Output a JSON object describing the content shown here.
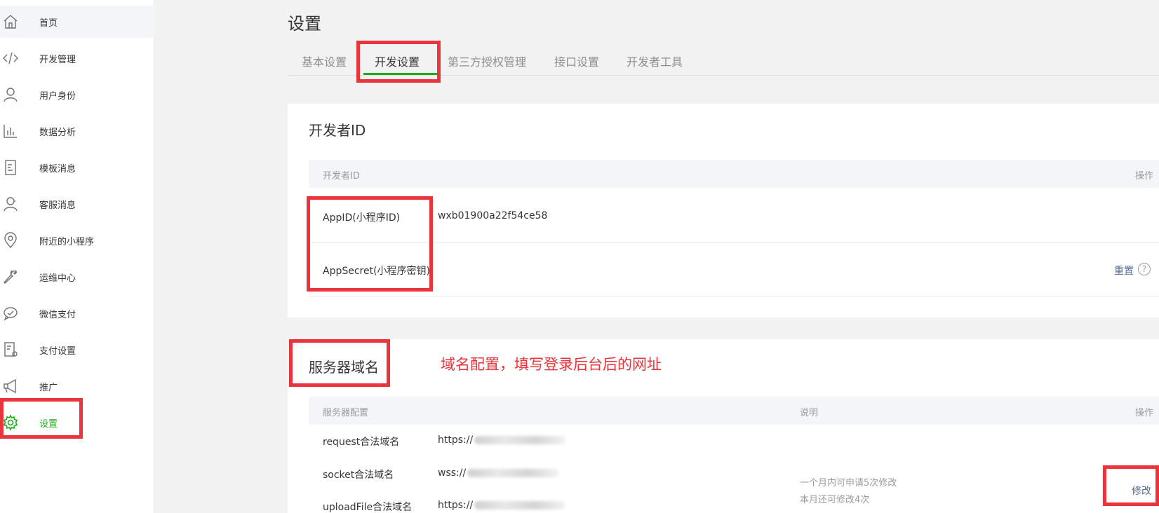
{
  "sidebar": {
    "items": [
      {
        "label": "首页",
        "icon": "home-icon"
      },
      {
        "label": "开发管理",
        "icon": "code-icon"
      },
      {
        "label": "用户身份",
        "icon": "user-icon"
      },
      {
        "label": "数据分析",
        "icon": "bar-chart-icon"
      },
      {
        "label": "模板消息",
        "icon": "document-icon"
      },
      {
        "label": "客服消息",
        "icon": "customer-service-icon"
      },
      {
        "label": "附近的小程序",
        "icon": "location-pin-icon"
      },
      {
        "label": "运维中心",
        "icon": "wrench-icon"
      },
      {
        "label": "微信支付",
        "icon": "wechat-pay-icon"
      },
      {
        "label": "支付设置",
        "icon": "payment-settings-icon"
      },
      {
        "label": "推广",
        "icon": "megaphone-icon"
      },
      {
        "label": "设置",
        "icon": "gear-icon"
      }
    ]
  },
  "page": {
    "title": "设置"
  },
  "tabs": [
    "基本设置",
    "开发设置",
    "第三方授权管理",
    "接口设置",
    "开发者工具"
  ],
  "developer_id": {
    "title": "开发者ID",
    "header_col1": "开发者ID",
    "header_action": "操作",
    "appid_label": "AppID(小程序ID)",
    "appid_value": "wxb01900a22f54ce58",
    "secret_label": "AppSecret(小程序密钥)",
    "reset_link": "重置",
    "help": "?"
  },
  "server_domain": {
    "title": "服务器域名",
    "annotation": "域名配置，填写登录后台后的网址",
    "header_config": "服务器配置",
    "header_desc": "说明",
    "header_action": "操作",
    "rows": [
      {
        "label": "request合法域名",
        "value": "https://"
      },
      {
        "label": "socket合法域名",
        "value": "wss://"
      },
      {
        "label": "uploadFile合法域名",
        "value": "https://"
      }
    ],
    "note_line1": "一个月内可申请5次修改",
    "note_line2": "本月还可修改4次",
    "modify_link": "修改"
  },
  "colors": {
    "accent": "#1aad19",
    "highlight": "#e8343a",
    "link": "#576b95"
  }
}
